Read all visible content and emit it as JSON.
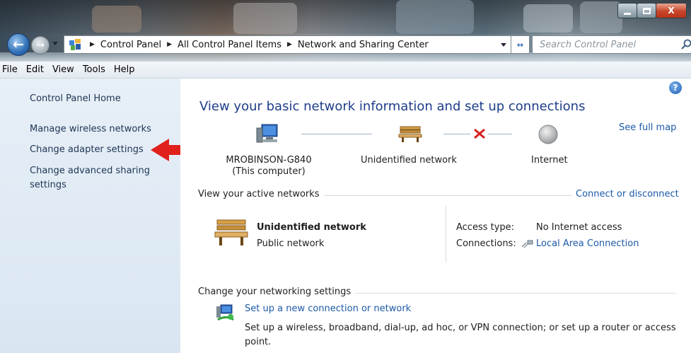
{
  "window": {
    "title_buttons": {
      "minimize": "minimize",
      "maximize": "maximize",
      "close": "X"
    }
  },
  "address_bar": {
    "breadcrumbs": [
      "Control Panel",
      "All Control Panel Items",
      "Network and Sharing Center"
    ],
    "search_placeholder": "Search Control Panel"
  },
  "menu": {
    "items": [
      "File",
      "Edit",
      "View",
      "Tools",
      "Help"
    ]
  },
  "sidebar": {
    "home": "Control Panel Home",
    "links": [
      "Manage wireless networks",
      "Change adapter settings",
      "Change advanced sharing settings"
    ]
  },
  "main": {
    "heading": "View your basic network information and set up connections",
    "see_full_map": "See full map",
    "map": {
      "computer_name": "MROBINSON-G840",
      "computer_sub": "(This computer)",
      "network": "Unidentified network",
      "internet": "Internet"
    },
    "active_networks": {
      "title": "View your active networks",
      "connect_link": "Connect or disconnect",
      "network_name": "Unidentified network",
      "network_type": "Public network",
      "access_type_label": "Access type:",
      "access_type_value": "No Internet access",
      "connections_label": "Connections:",
      "connections_value": "Local Area Connection"
    },
    "change_settings": {
      "title": "Change your networking settings",
      "setup_link": "Set up a new connection or network",
      "setup_desc": "Set up a wireless, broadband, dial-up, ad hoc, or VPN connection; or set up a router or access point."
    }
  },
  "colors": {
    "link": "#1c5aa8",
    "heading": "#1e3d8a",
    "arrow": "#e0201b",
    "sidebar": "#e4edf6"
  }
}
